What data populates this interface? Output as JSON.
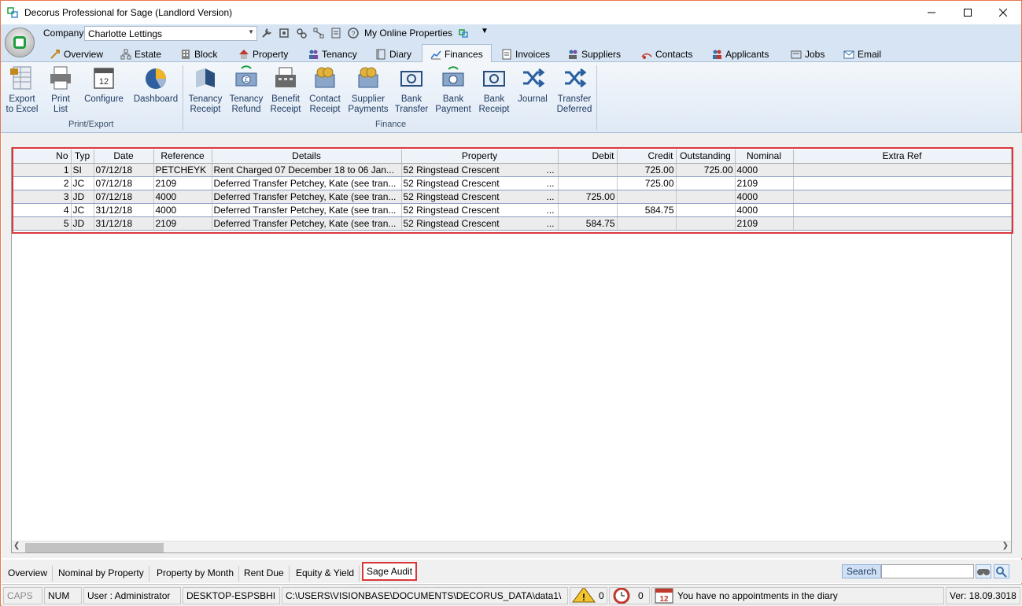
{
  "window": {
    "title": "Decorus Professional  for Sage (Landlord Version)"
  },
  "qat": {
    "company_label": "Company",
    "company_value": "Charlotte Lettings",
    "online_label": "My Online Properties"
  },
  "tabs": [
    {
      "label": "Overview",
      "icon": "overview-icon"
    },
    {
      "label": "Estate",
      "icon": "estate-icon"
    },
    {
      "label": "Block",
      "icon": "block-icon"
    },
    {
      "label": "Property",
      "icon": "property-icon"
    },
    {
      "label": "Tenancy",
      "icon": "tenancy-icon"
    },
    {
      "label": "Diary",
      "icon": "diary-icon"
    },
    {
      "label": "Finances",
      "icon": "finances-icon",
      "active": true
    },
    {
      "label": "Invoices",
      "icon": "invoices-icon"
    },
    {
      "label": "Suppliers",
      "icon": "suppliers-icon"
    },
    {
      "label": "Contacts",
      "icon": "contacts-icon"
    },
    {
      "label": "Applicants",
      "icon": "applicants-icon"
    },
    {
      "label": "Jobs",
      "icon": "jobs-icon"
    },
    {
      "label": "Email",
      "icon": "email-icon"
    }
  ],
  "ribbon": {
    "groups": [
      {
        "label": "Print/Export"
      },
      {
        "label": "Finance"
      }
    ],
    "buttons": [
      {
        "line1": "Export",
        "line2": "to Excel",
        "icon": "excel-icon"
      },
      {
        "line1": "Print",
        "line2": "List",
        "icon": "printer-icon"
      },
      {
        "line1": "Configure",
        "line2": "",
        "icon": "calendar-icon"
      },
      {
        "line1": "Dashboard",
        "line2": "",
        "icon": "pie-chart-icon"
      },
      {
        "line1": "Tenancy",
        "line2": "Receipt",
        "icon": "receipt-icon"
      },
      {
        "line1": "Tenancy",
        "line2": "Refund",
        "icon": "money-icon"
      },
      {
        "line1": "Benefit",
        "line2": "Receipt",
        "icon": "till-icon"
      },
      {
        "line1": "Contact",
        "line2": "Receipt",
        "icon": "coins-icon"
      },
      {
        "line1": "Supplier",
        "line2": "Payments",
        "icon": "coins-icon"
      },
      {
        "line1": "Bank",
        "line2": "Transfer",
        "icon": "banknote-icon"
      },
      {
        "line1": "Bank",
        "line2": "Payment",
        "icon": "banknote-icon"
      },
      {
        "line1": "Bank",
        "line2": "Receipt",
        "icon": "banknote-icon"
      },
      {
        "line1": "Journal",
        "line2": "",
        "icon": "shuffle-icon"
      },
      {
        "line1": "Transfer",
        "line2": "Deferred",
        "icon": "shuffle-icon"
      }
    ]
  },
  "table": {
    "columns": [
      "No",
      "Typ",
      "Date",
      "Reference",
      "Details",
      "Property",
      "Debit",
      "Credit",
      "Outstanding",
      "Nominal",
      "Extra Ref"
    ],
    "rows": [
      {
        "no": "1",
        "typ": "SI",
        "date": "07/12/18",
        "ref": "PETCHEYK",
        "details": "Rent Charged 07 December 18 to 06 Jan...",
        "property": "52 Ringstead Crescent",
        "debit": "",
        "credit": "725.00",
        "outstanding": "725.00",
        "nominal": "4000",
        "extra": ""
      },
      {
        "no": "2",
        "typ": "JC",
        "date": "07/12/18",
        "ref": "2109",
        "details": "Deferred Transfer Petchey, Kate (see tran...",
        "property": "52 Ringstead Crescent",
        "debit": "",
        "credit": "725.00",
        "outstanding": "",
        "nominal": "2109",
        "extra": ""
      },
      {
        "no": "3",
        "typ": "JD",
        "date": "07/12/18",
        "ref": "4000",
        "details": "Deferred Transfer Petchey, Kate (see tran...",
        "property": "52 Ringstead Crescent",
        "debit": "725.00",
        "credit": "",
        "outstanding": "",
        "nominal": "4000",
        "extra": ""
      },
      {
        "no": "4",
        "typ": "JC",
        "date": "31/12/18",
        "ref": "4000",
        "details": "Deferred Transfer Petchey, Kate (see tran...",
        "property": "52 Ringstead Crescent",
        "debit": "",
        "credit": "584.75",
        "outstanding": "",
        "nominal": "4000",
        "extra": ""
      },
      {
        "no": "5",
        "typ": "JD",
        "date": "31/12/18",
        "ref": "2109",
        "details": "Deferred Transfer Petchey, Kate (see tran...",
        "property": "52 Ringstead Crescent",
        "debit": "584.75",
        "credit": "",
        "outstanding": "",
        "nominal": "2109",
        "extra": ""
      }
    ],
    "ellipsis": "..."
  },
  "bottom_tabs": [
    {
      "label": "Overview"
    },
    {
      "label": "Nominal by Property"
    },
    {
      "label": "Property by Month"
    },
    {
      "label": "Rent Due"
    },
    {
      "label": "Equity & Yield"
    },
    {
      "label": "Sage Audit",
      "active": true
    }
  ],
  "search": {
    "label": "Search",
    "value": ""
  },
  "status": {
    "caps": "CAPS",
    "num": "NUM",
    "user": "User : Administrator",
    "machine": "DESKTOP-ESPSBHI",
    "path": "C:\\USERS\\VISIONBASE\\DOCUMENTS\\DECORUS_DATA\\data1\\",
    "warnings_count": "0",
    "alarms_count": "0",
    "calendar_day": "12",
    "diary_message": "You have no appointments in the diary",
    "version": "Ver: 18.09.3018"
  },
  "colors": {
    "highlight_border": "#d9383b",
    "ribbon_bg": "#dfe9f5",
    "accent_green": "#1f9e3f"
  }
}
